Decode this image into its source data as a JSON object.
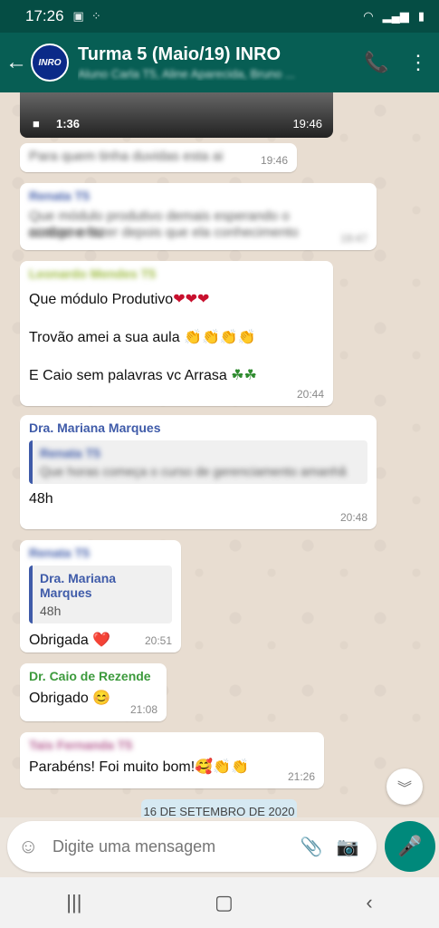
{
  "status": {
    "time": "17:26"
  },
  "header": {
    "back_glyph": "←",
    "avatar_text": "INRO",
    "title": "Turma 5  (Maio/19) INRO",
    "subtitle": "Aluno Carla T5, Aline Aparecida, Bruno ...",
    "call_glyph": "📞",
    "menu_glyph": "⋮"
  },
  "messages": {
    "video": {
      "duration": "1:36",
      "time": "19:46"
    },
    "m1": {
      "text": "Para quem tinha duvidas esta ai",
      "time": "19:46"
    },
    "m2": {
      "sender": "Renata T5",
      "line1": "Que módulo produtivo demais esperando o acabamento",
      "line2": "contigo e fazer depois que ela conhecimento",
      "time": "19:47"
    },
    "m3": {
      "sender": "Leonardo Mendes T5",
      "line1": "Que módulo Produtivo",
      "hearts1": "❤❤❤",
      "line2": "Trovão amei a sua aula",
      "clap1": "👏👏👏👏",
      "line3": "E Caio sem palavras vc Arrasa",
      "clovers": "☘☘",
      "time": "20:44"
    },
    "m4": {
      "sender": "Dra. Mariana Marques",
      "quote_sender": "Renata T5",
      "quote_text": "Que horas começa o curso de gerenciamento amanhã",
      "body": "48h",
      "time": "20:48"
    },
    "m5": {
      "sender": "Renata T5",
      "quote_sender": "Dra. Mariana Marques",
      "quote_text": "48h",
      "body": "Obrigada",
      "emoji": "❤️",
      "time": "20:51"
    },
    "m6": {
      "sender": "Dr. Caio de Rezende",
      "body": "Obrigado",
      "emoji": "😊",
      "time": "21:08"
    },
    "m7": {
      "sender": "Tais Fernanda T5",
      "body": "Parabéns!  Foi muito bom!",
      "emoji": "🥰👏👏",
      "time": "21:26"
    }
  },
  "date_chip": "16 DE SETEMBRO DE 2020",
  "composer": {
    "placeholder": "Digite uma mensagem"
  },
  "colors": {
    "header": "#075e54",
    "statusbar": "#054d44",
    "accent": "#00897b",
    "sender_blue": "#3f5ba9",
    "sender_green": "#3c9a3c",
    "sender_olive": "#9ab93b",
    "sender_pink": "#b35a8f"
  }
}
